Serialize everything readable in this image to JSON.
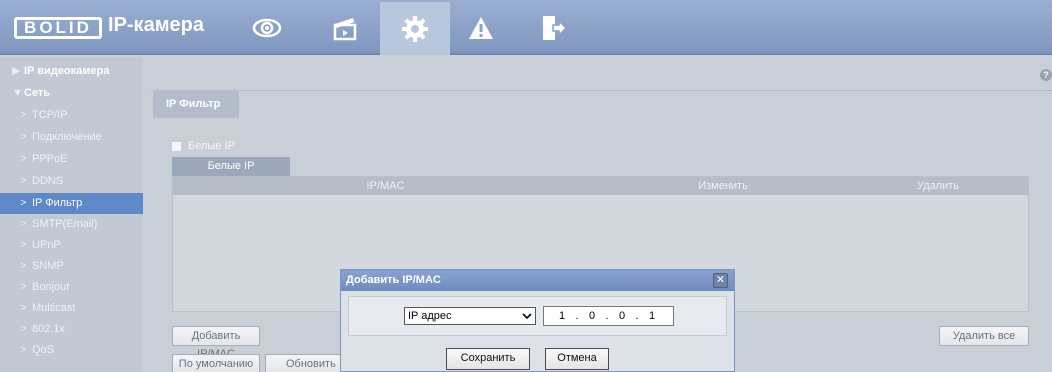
{
  "header": {
    "logo": "BOLID",
    "brand": "IP-камера",
    "nav": [
      {
        "icon": "eye-icon"
      },
      {
        "icon": "clapperboard-icon"
      },
      {
        "icon": "gear-icon"
      },
      {
        "icon": "warning-icon"
      },
      {
        "icon": "logout-icon"
      }
    ]
  },
  "sidebar": {
    "items": [
      {
        "label": "IP видеокамера",
        "type": "top",
        "prefix": "▶"
      },
      {
        "label": "Сеть",
        "type": "top",
        "prefix": "▼"
      },
      {
        "label": "TCP/IP",
        "type": "sub",
        "prefix": ">"
      },
      {
        "label": "Подключение",
        "type": "sub",
        "prefix": ">"
      },
      {
        "label": "PPPoE",
        "type": "sub",
        "prefix": ">"
      },
      {
        "label": "DDNS",
        "type": "sub",
        "prefix": ">"
      },
      {
        "label": "IP Фильтр",
        "type": "sub",
        "prefix": ">",
        "selected": true
      },
      {
        "label": "SMTP(Email)",
        "type": "sub",
        "prefix": ">"
      },
      {
        "label": "UPnP",
        "type": "sub",
        "prefix": ">"
      },
      {
        "label": "SNMP",
        "type": "sub",
        "prefix": ">"
      },
      {
        "label": "Bonjour",
        "type": "sub",
        "prefix": ">"
      },
      {
        "label": "Multicast",
        "type": "sub",
        "prefix": ">"
      },
      {
        "label": "802.1x",
        "type": "sub",
        "prefix": ">"
      },
      {
        "label": "QoS",
        "type": "sub",
        "prefix": ">"
      }
    ]
  },
  "main": {
    "tab": "IP Фильтр",
    "help": "?",
    "checkbox_label": "Белые IP",
    "subtab": "Белые IP",
    "columns": [
      "IP/MAC",
      "Изменить",
      "Удалить"
    ],
    "buttons": {
      "add": "Добавить IP/MAC",
      "delete_all": "Удалить все",
      "default": "По умолчанию",
      "refresh": "Обновить"
    }
  },
  "dialog": {
    "title": "Добавить IP/MAC",
    "close": "✕",
    "select_value": "IP адрес",
    "ip": [
      "1",
      "0",
      "0",
      "1"
    ],
    "save": "Сохранить",
    "cancel": "Отмена"
  },
  "colors": {
    "header": "#8aa0c8",
    "selected": "#5e88c8",
    "dialog_title": "#7b95c6"
  }
}
